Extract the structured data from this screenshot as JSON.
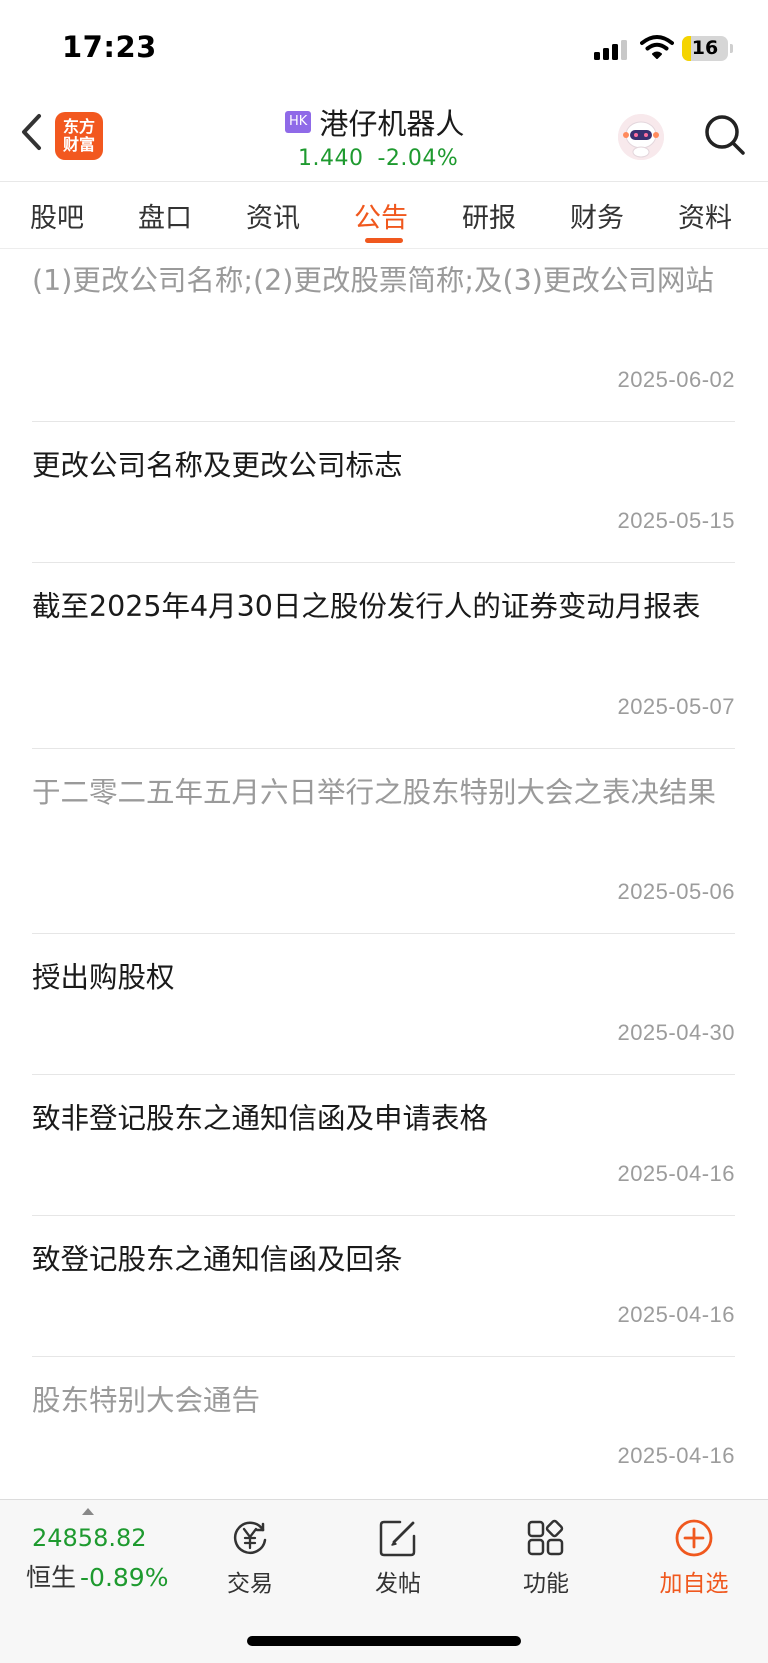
{
  "status_bar": {
    "time": "17:23",
    "battery": "16",
    "signal_icon": "cellular-signal-icon",
    "wifi_icon": "wifi-icon"
  },
  "header": {
    "back_icon": "chevron-left-icon",
    "logo_text_line1": "东方",
    "logo_text_line2": "财富",
    "market_badge": "HK",
    "stock_name": "港仔机器人",
    "price": "1.440",
    "change_pct": "-2.04%",
    "assistant_icon": "robot-avatar-icon",
    "search_icon": "search-icon"
  },
  "tabs": [
    {
      "label": "股吧",
      "active": false
    },
    {
      "label": "盘口",
      "active": false
    },
    {
      "label": "资讯",
      "active": false
    },
    {
      "label": "公告",
      "active": true
    },
    {
      "label": "研报",
      "active": false
    },
    {
      "label": "财务",
      "active": false
    },
    {
      "label": "资料",
      "active": false
    }
  ],
  "announcements": [
    {
      "title": "(1)更改公司名称;(2)更改股票简称;及(3)更改公司网站",
      "date": "2025-06-02",
      "read": true
    },
    {
      "title": "更改公司名称及更改公司标志",
      "date": "2025-05-15",
      "read": false
    },
    {
      "title": "截至2025年4月30日之股份发行人的证券变动月报表",
      "date": "2025-05-07",
      "read": false
    },
    {
      "title": "于二零二五年五月六日举行之股东特别大会之表决结果",
      "date": "2025-05-06",
      "read": true
    },
    {
      "title": "授出购股权",
      "date": "2025-04-30",
      "read": false
    },
    {
      "title": "致非登记股东之通知信函及申请表格",
      "date": "2025-04-16",
      "read": false
    },
    {
      "title": "致登记股东之通知信函及回条",
      "date": "2025-04-16",
      "read": false
    },
    {
      "title": "股东特别大会通告",
      "date": "2025-04-16",
      "read": true
    }
  ],
  "bottom_bar": {
    "index_value": "24858.82",
    "index_name": "恒生",
    "index_change": "-0.89%",
    "trade_label": "交易",
    "post_label": "发帖",
    "functions_label": "功能",
    "add_watchlist_label": "加自选"
  },
  "colors": {
    "accent": "#f0581e",
    "down_green": "#1e9a2f",
    "read_gray": "#9a9a9a"
  }
}
